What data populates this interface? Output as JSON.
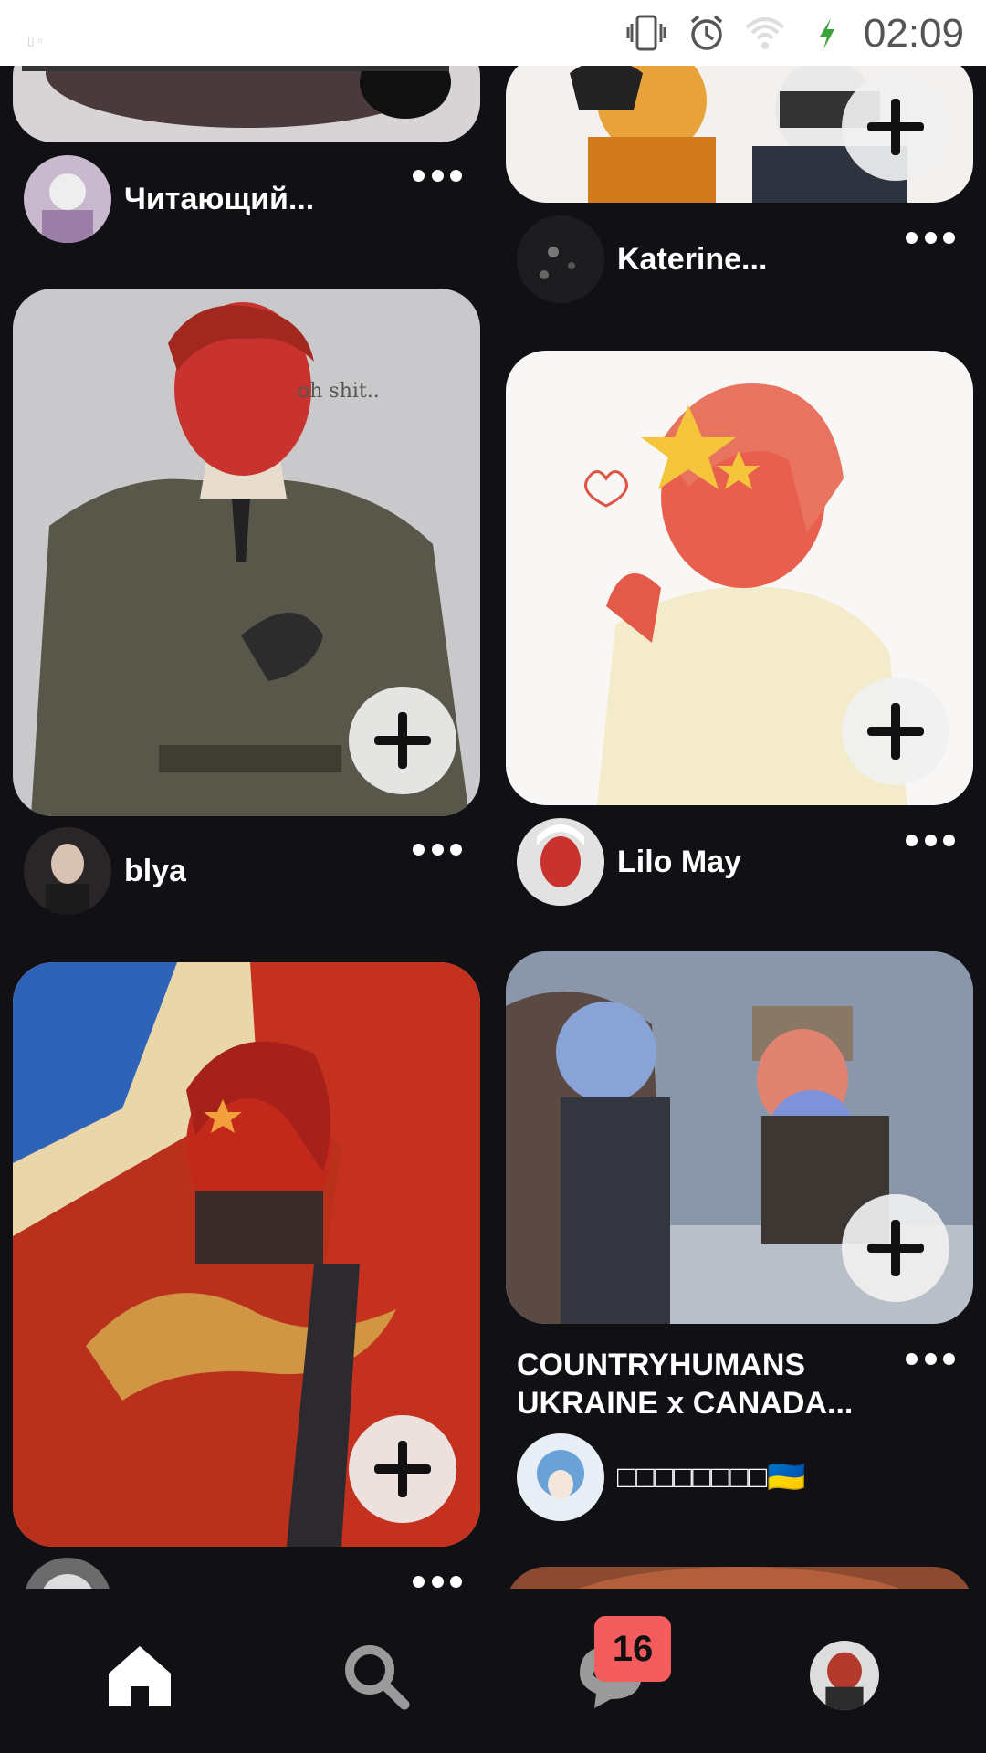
{
  "status_bar": {
    "time": "02:09",
    "icons": [
      "vibrate-icon",
      "alarm-icon",
      "wifi-icon",
      "charging-icon"
    ]
  },
  "feed": {
    "pins": [
      {
        "name": "Читающий..."
      },
      {
        "name": "Katerine..."
      },
      {
        "name": "blya"
      },
      {
        "name": "Lilo May"
      },
      {
        "title_line1": "COUNTRYHUMANS",
        "title_line2": "UKRAINE x CANADA...",
        "name": "□□□□□□□□🇺🇦"
      }
    ],
    "image_text": "oh shit.."
  },
  "bottom_nav": {
    "items": [
      "home-icon",
      "search-icon",
      "messages-icon",
      "profile-avatar"
    ],
    "notification_count": "16"
  },
  "colors": {
    "background": "#111014",
    "badge": "#f25c5c",
    "plus_button": "#f0f0f0"
  }
}
